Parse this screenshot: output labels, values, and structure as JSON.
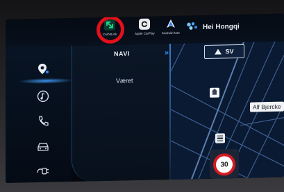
{
  "topbar": {
    "apps": [
      {
        "name": "carbitlink",
        "label": "CarbitLink",
        "icon": "link-arrows-icon",
        "color": "#1fd08a"
      },
      {
        "name": "applecarplay",
        "label": "Apple CarPlay",
        "icon": "carplay-icon"
      },
      {
        "name": "androidauto",
        "label": "Android Auto",
        "icon": "android-auto-icon"
      }
    ],
    "hongqi": {
      "label": "Hei Hongqi",
      "icon": "voice-assistant-icon"
    },
    "highlight_color": "#e2101a"
  },
  "sidebar": {
    "items": [
      {
        "name": "navigation",
        "icon": "location-pin-icon",
        "active": true
      },
      {
        "name": "media",
        "icon": "music-note-icon"
      },
      {
        "name": "phone",
        "icon": "phone-icon"
      },
      {
        "name": "vehicle",
        "icon": "car-icon"
      },
      {
        "name": "charging",
        "icon": "charging-plug-icon"
      }
    ]
  },
  "panel": {
    "title": "NAVI",
    "arrow": "»",
    "items": [
      {
        "label": "Været"
      }
    ]
  },
  "map": {
    "direction": "SV",
    "street_name": "Alf Bjercke",
    "speed_limit": "30",
    "accent_color": "#2e8bff"
  }
}
